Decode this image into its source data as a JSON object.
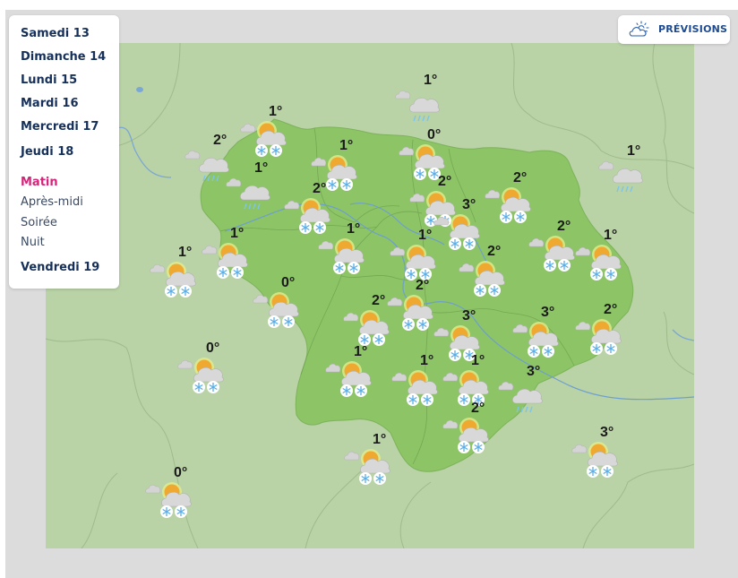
{
  "sidebar": {
    "days": [
      {
        "label": "Samedi 13"
      },
      {
        "label": "Dimanche 14"
      },
      {
        "label": "Lundi 15"
      },
      {
        "label": "Mardi 16"
      },
      {
        "label": "Mercredi 17"
      },
      {
        "label": "Jeudi 18"
      },
      {
        "label": "Vendredi 19"
      }
    ],
    "periods": [
      {
        "label": "Matin",
        "active": true
      },
      {
        "label": "Après-midi",
        "active": false
      },
      {
        "label": "Soirée",
        "active": false
      },
      {
        "label": "Nuit",
        "active": false
      }
    ]
  },
  "forecast_button": {
    "label": "PRÉVISIONS",
    "icon": "partly-cloudy-icon"
  },
  "colors": {
    "active_period": "#d6247a",
    "day_text": "#16305a",
    "button_text": "#1e4b8f",
    "map_outside": "#b9d2a6",
    "map_region": "#8cc466"
  },
  "weather_markers": [
    {
      "temp": "1°",
      "type": "sun-cloud-snow"
    },
    {
      "temp": "2°",
      "type": "cloud-rain"
    },
    {
      "temp": "1°",
      "type": "cloud-rain"
    },
    {
      "temp": "1°",
      "type": "cloud-rain"
    },
    {
      "temp": "1°",
      "type": "sun-cloud-snow"
    },
    {
      "temp": "0°",
      "type": "sun-cloud-snow"
    },
    {
      "temp": "1°",
      "type": "cloud-rain"
    },
    {
      "temp": "2°",
      "type": "sun-cloud-snow"
    },
    {
      "temp": "2°",
      "type": "sun-cloud-snow"
    },
    {
      "temp": "2°",
      "type": "sun-cloud-snow"
    },
    {
      "temp": "3°",
      "type": "sun-cloud-snow"
    },
    {
      "temp": "1°",
      "type": "sun-cloud-snow"
    },
    {
      "temp": "1°",
      "type": "sun-cloud-snow"
    },
    {
      "temp": "1°",
      "type": "sun-cloud-snow"
    },
    {
      "temp": "1°",
      "type": "sun-cloud-snow"
    },
    {
      "temp": "2°",
      "type": "sun-cloud-snow"
    },
    {
      "temp": "2°",
      "type": "sun-cloud-snow"
    },
    {
      "temp": "1°",
      "type": "sun-cloud-snow"
    },
    {
      "temp": "0°",
      "type": "sun-cloud-snow"
    },
    {
      "temp": "2°",
      "type": "sun-cloud-snow"
    },
    {
      "temp": "2°",
      "type": "sun-cloud-snow"
    },
    {
      "temp": "3°",
      "type": "sun-cloud-snow"
    },
    {
      "temp": "3°",
      "type": "sun-cloud-snow"
    },
    {
      "temp": "2°",
      "type": "sun-cloud-snow"
    },
    {
      "temp": "0°",
      "type": "sun-cloud-snow"
    },
    {
      "temp": "1°",
      "type": "sun-cloud-snow"
    },
    {
      "temp": "1°",
      "type": "sun-cloud-snow"
    },
    {
      "temp": "1°",
      "type": "sun-cloud-snow"
    },
    {
      "temp": "3°",
      "type": "cloud-rain"
    },
    {
      "temp": "2°",
      "type": "sun-cloud-snow"
    },
    {
      "temp": "3°",
      "type": "sun-cloud-snow"
    },
    {
      "temp": "1°",
      "type": "sun-cloud-snow"
    },
    {
      "temp": "0°",
      "type": "sun-cloud-snow"
    }
  ]
}
